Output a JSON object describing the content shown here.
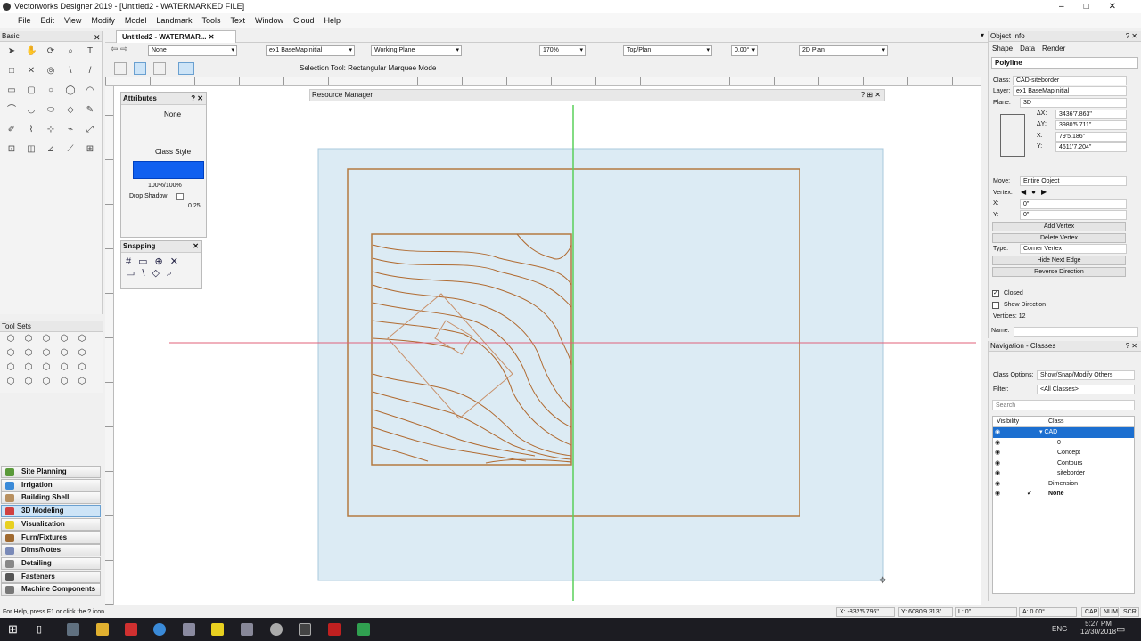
{
  "window": {
    "title": "Vectorworks Designer 2019 - [Untitled2 - WATERMARKED FILE]"
  },
  "menu": [
    "File",
    "Edit",
    "View",
    "Modify",
    "Model",
    "Landmark",
    "Tools",
    "Text",
    "Window",
    "Cloud",
    "Help"
  ],
  "basic_palette": {
    "title": "Basic"
  },
  "tool_sets": {
    "title": "Tool Sets"
  },
  "workspaces": [
    {
      "label": "Site Planning",
      "color": "#5a9a3a"
    },
    {
      "label": "Irrigation",
      "color": "#3a8ad8"
    },
    {
      "label": "Building Shell",
      "color": "#b89060"
    },
    {
      "label": "3D Modeling",
      "color": "#d04040",
      "active": true
    },
    {
      "label": "Visualization",
      "color": "#e8d020"
    },
    {
      "label": "Furn/Fixtures",
      "color": "#a06a30"
    },
    {
      "label": "Dims/Notes",
      "color": "#7a8ab8"
    },
    {
      "label": "Detailing",
      "color": "#888888"
    },
    {
      "label": "Fasteners",
      "color": "#555555"
    },
    {
      "label": "Machine Components",
      "color": "#777777"
    }
  ],
  "doc_tab": "Untitled2 - WATERMAR...",
  "view_bar": {
    "class": "None",
    "layer": "ex1 BaseMapInitial",
    "plane": "Working Plane",
    "zoom": "170%",
    "view": "Top/Plan",
    "rotation": "0.00°",
    "render": "2D Plan"
  },
  "mode_bar": {
    "hint": "Selection Tool: Rectangular Marquee Mode"
  },
  "attributes": {
    "title": "Attributes",
    "fill": "None",
    "pen": "Class Style",
    "opacity": "100%/100%",
    "drop_shadow": "Drop Shadow",
    "line_weight": "0.25"
  },
  "snapping": {
    "title": "Snapping"
  },
  "resource_manager": {
    "title": "Resource Manager"
  },
  "object_info": {
    "title": "Object Info",
    "tabs": [
      "Shape",
      "Data",
      "Render"
    ],
    "type": "Polyline",
    "class_label": "Class:",
    "class": "CAD-siteborder",
    "layer_label": "Layer:",
    "layer": "ex1 BaseMapInitial",
    "plane_label": "Plane:",
    "plane": "3D",
    "dx_label": "ΔX:",
    "dx": "3436'7.863\"",
    "dy_label": "ΔY:",
    "dy": "3980'5.711\"",
    "x_label": "X:",
    "x": "79'5.186\"",
    "y_label": "Y:",
    "y": "4611'7.204\"",
    "move_label": "Move:",
    "move": "Entire Object",
    "vertex_label": "Vertex:",
    "vx_label": "X:",
    "vx": "0\"",
    "vy_label": "Y:",
    "vy": "0\"",
    "add_vertex": "Add Vertex",
    "delete_vertex": "Delete Vertex",
    "type_label": "Type:",
    "vertex_type": "Corner Vertex",
    "hide_next_edge": "Hide Next Edge",
    "reverse_direction": "Reverse Direction",
    "closed": "Closed",
    "closed_checked": true,
    "show_direction": "Show Direction",
    "show_direction_checked": false,
    "vertices": "Vertices:  12",
    "name_label": "Name:"
  },
  "navigation": {
    "title": "Navigation - Classes",
    "class_options_label": "Class Options:",
    "class_options": "Show/Snap/Modify Others",
    "filter_label": "Filter:",
    "filter": "<All Classes>",
    "search_placeholder": "Search",
    "col_visibility": "Visibility",
    "col_class": "Class",
    "classes": [
      {
        "name": "▾ CAD",
        "indent": 1,
        "selected": true
      },
      {
        "name": "0",
        "indent": 2
      },
      {
        "name": "Concept",
        "indent": 2
      },
      {
        "name": "Contours",
        "indent": 2
      },
      {
        "name": "siteborder",
        "indent": 2
      },
      {
        "name": "Dimension",
        "indent": 1
      },
      {
        "name": "None",
        "indent": 1,
        "active": true
      }
    ]
  },
  "status": {
    "help": "For Help, press F1 or click the ? icon",
    "x": "X: -832'5.796\"",
    "y": "Y: 6080'9.313\"",
    "l": "L: 0\"",
    "a": "A: 0.00°",
    "cap": "CAP",
    "num": "NUM",
    "scrl": "SCRL"
  },
  "taskbar": {
    "lang": "ENG",
    "time": "5:27 PM",
    "date": "12/30/2018"
  }
}
